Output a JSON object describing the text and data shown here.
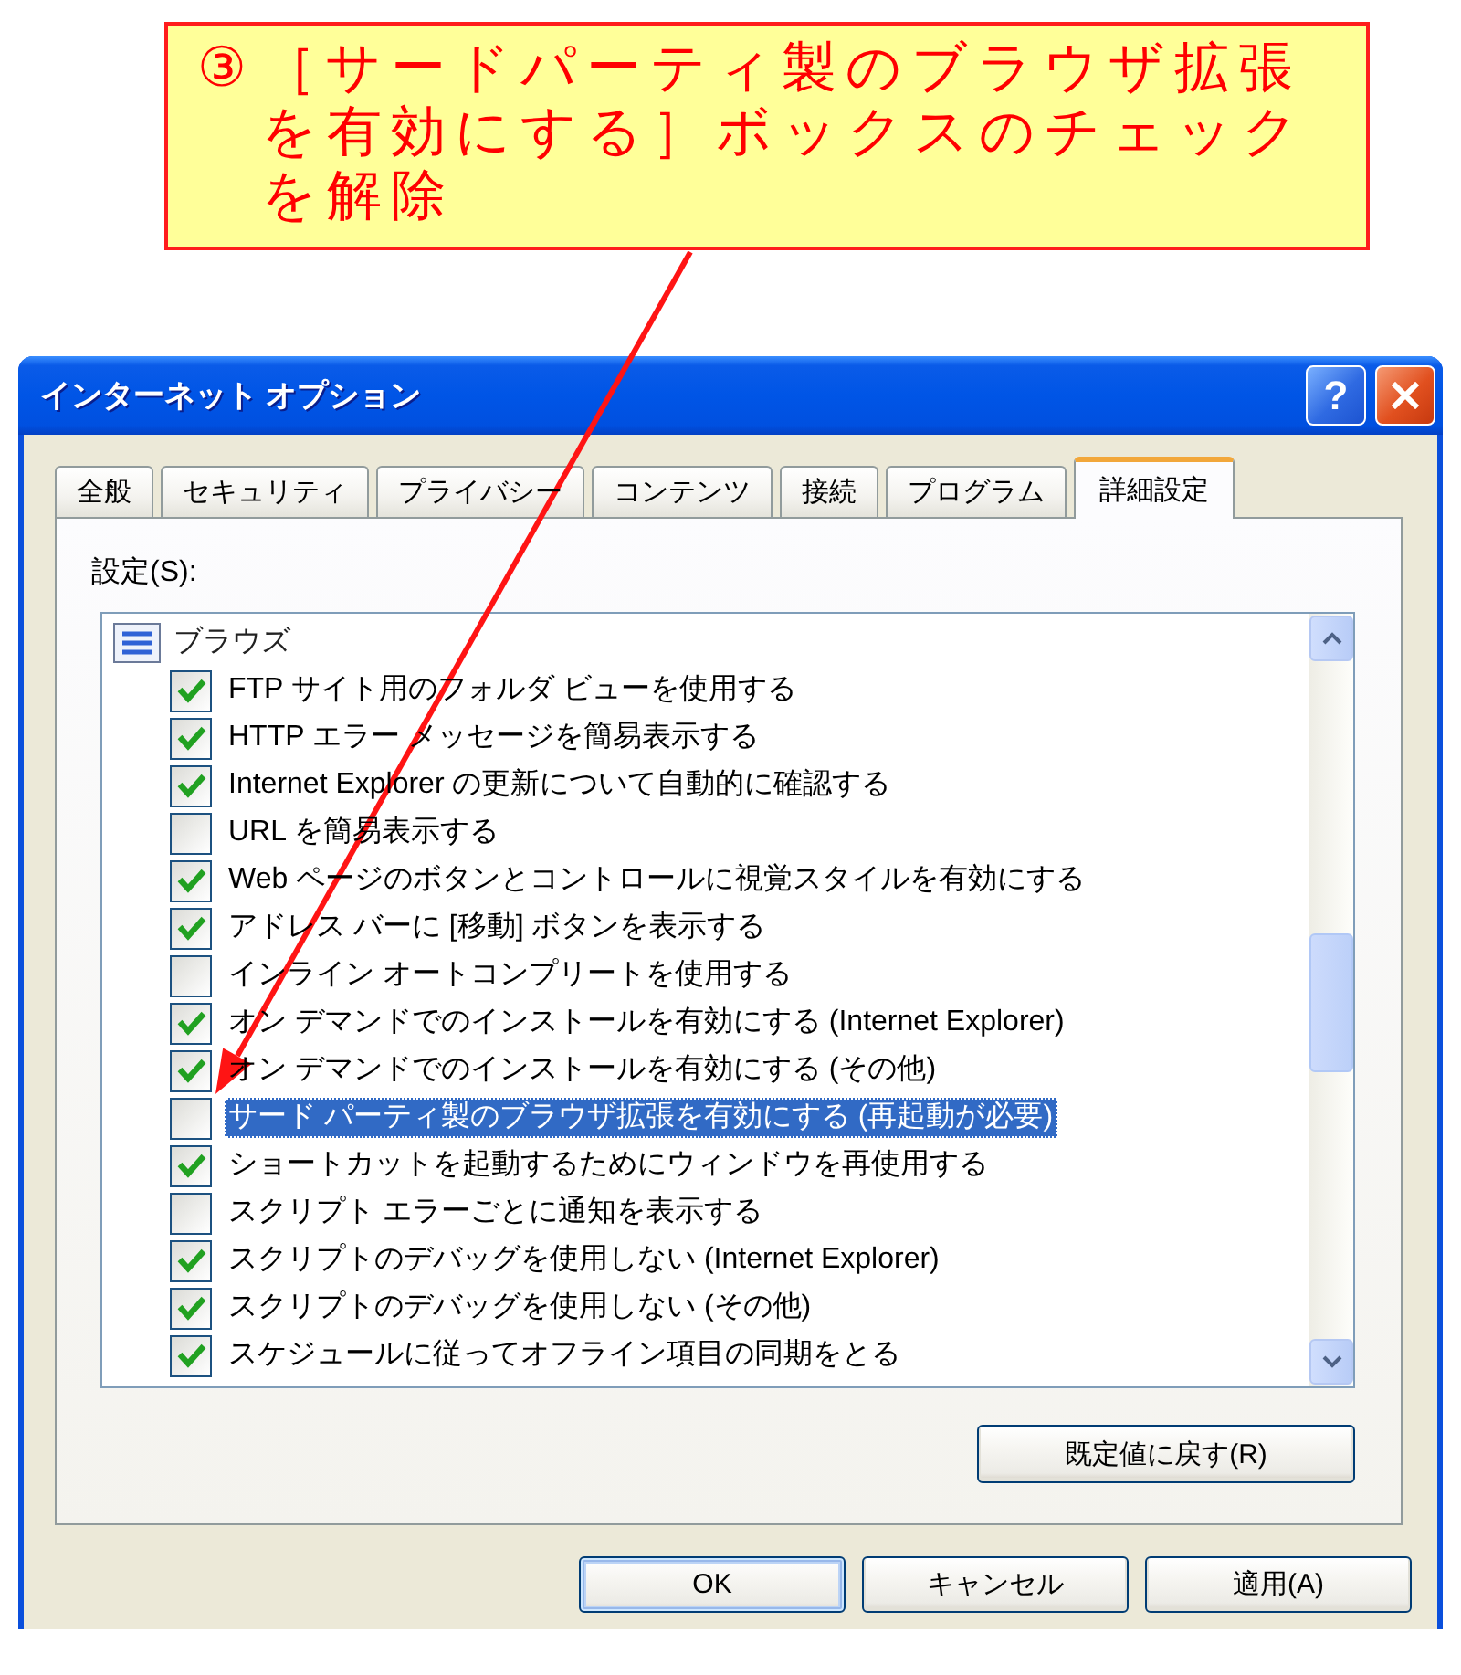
{
  "callout": {
    "marker": "③",
    "text": "［サードパーティ製のブラウザ拡張を有効にする］ボックスのチェックを解除"
  },
  "window": {
    "title": "インターネット オプション",
    "help_button": "?"
  },
  "tabs": [
    {
      "label": "全般",
      "selected": false
    },
    {
      "label": "セキュリティ",
      "selected": false
    },
    {
      "label": "プライバシー",
      "selected": false
    },
    {
      "label": "コンテンツ",
      "selected": false
    },
    {
      "label": "接続",
      "selected": false
    },
    {
      "label": "プログラム",
      "selected": false
    },
    {
      "label": "詳細設定",
      "selected": true
    }
  ],
  "settings": {
    "label": "設定(S):",
    "tree": [
      {
        "label": "ブラウズ",
        "children": [
          {
            "label": "FTP サイト用のフォルダ ビューを使用する",
            "checked": true,
            "selected": false
          },
          {
            "label": "HTTP エラー メッセージを簡易表示する",
            "checked": true,
            "selected": false
          },
          {
            "label": "Internet Explorer の更新について自動的に確認する",
            "checked": true,
            "selected": false
          },
          {
            "label": "URL を簡易表示する",
            "checked": false,
            "selected": false
          },
          {
            "label": "Web ページのボタンとコントロールに視覚スタイルを有効にする",
            "checked": true,
            "selected": false
          },
          {
            "label": "アドレス バーに [移動] ボタンを表示する",
            "checked": true,
            "selected": false
          },
          {
            "label": "インライン オートコンプリートを使用する",
            "checked": false,
            "selected": false
          },
          {
            "label": "オン デマンドでのインストールを有効にする (Internet Explorer)",
            "checked": true,
            "selected": false
          },
          {
            "label": "オン デマンドでのインストールを有効にする (その他)",
            "checked": true,
            "selected": false
          },
          {
            "label": "サード パーティ製のブラウザ拡張を有効にする (再起動が必要)",
            "checked": false,
            "selected": true
          },
          {
            "label": "ショートカットを起動するためにウィンドウを再使用する",
            "checked": true,
            "selected": false
          },
          {
            "label": "スクリプト エラーごとに通知を表示する",
            "checked": false,
            "selected": false
          },
          {
            "label": "スクリプトのデバッグを使用しない (Internet Explorer)",
            "checked": true,
            "selected": false
          },
          {
            "label": "スクリプトのデバッグを使用しない (その他)",
            "checked": true,
            "selected": false
          },
          {
            "label": "スケジュールに従ってオフライン項目の同期をとる",
            "checked": true,
            "selected": false
          }
        ]
      }
    ],
    "reset_button": "既定値に戻す(R)"
  },
  "buttons": [
    {
      "label": "OK",
      "default": true
    },
    {
      "label": "キャンセル",
      "default": false
    },
    {
      "label": "適用(A)",
      "default": false
    }
  ]
}
